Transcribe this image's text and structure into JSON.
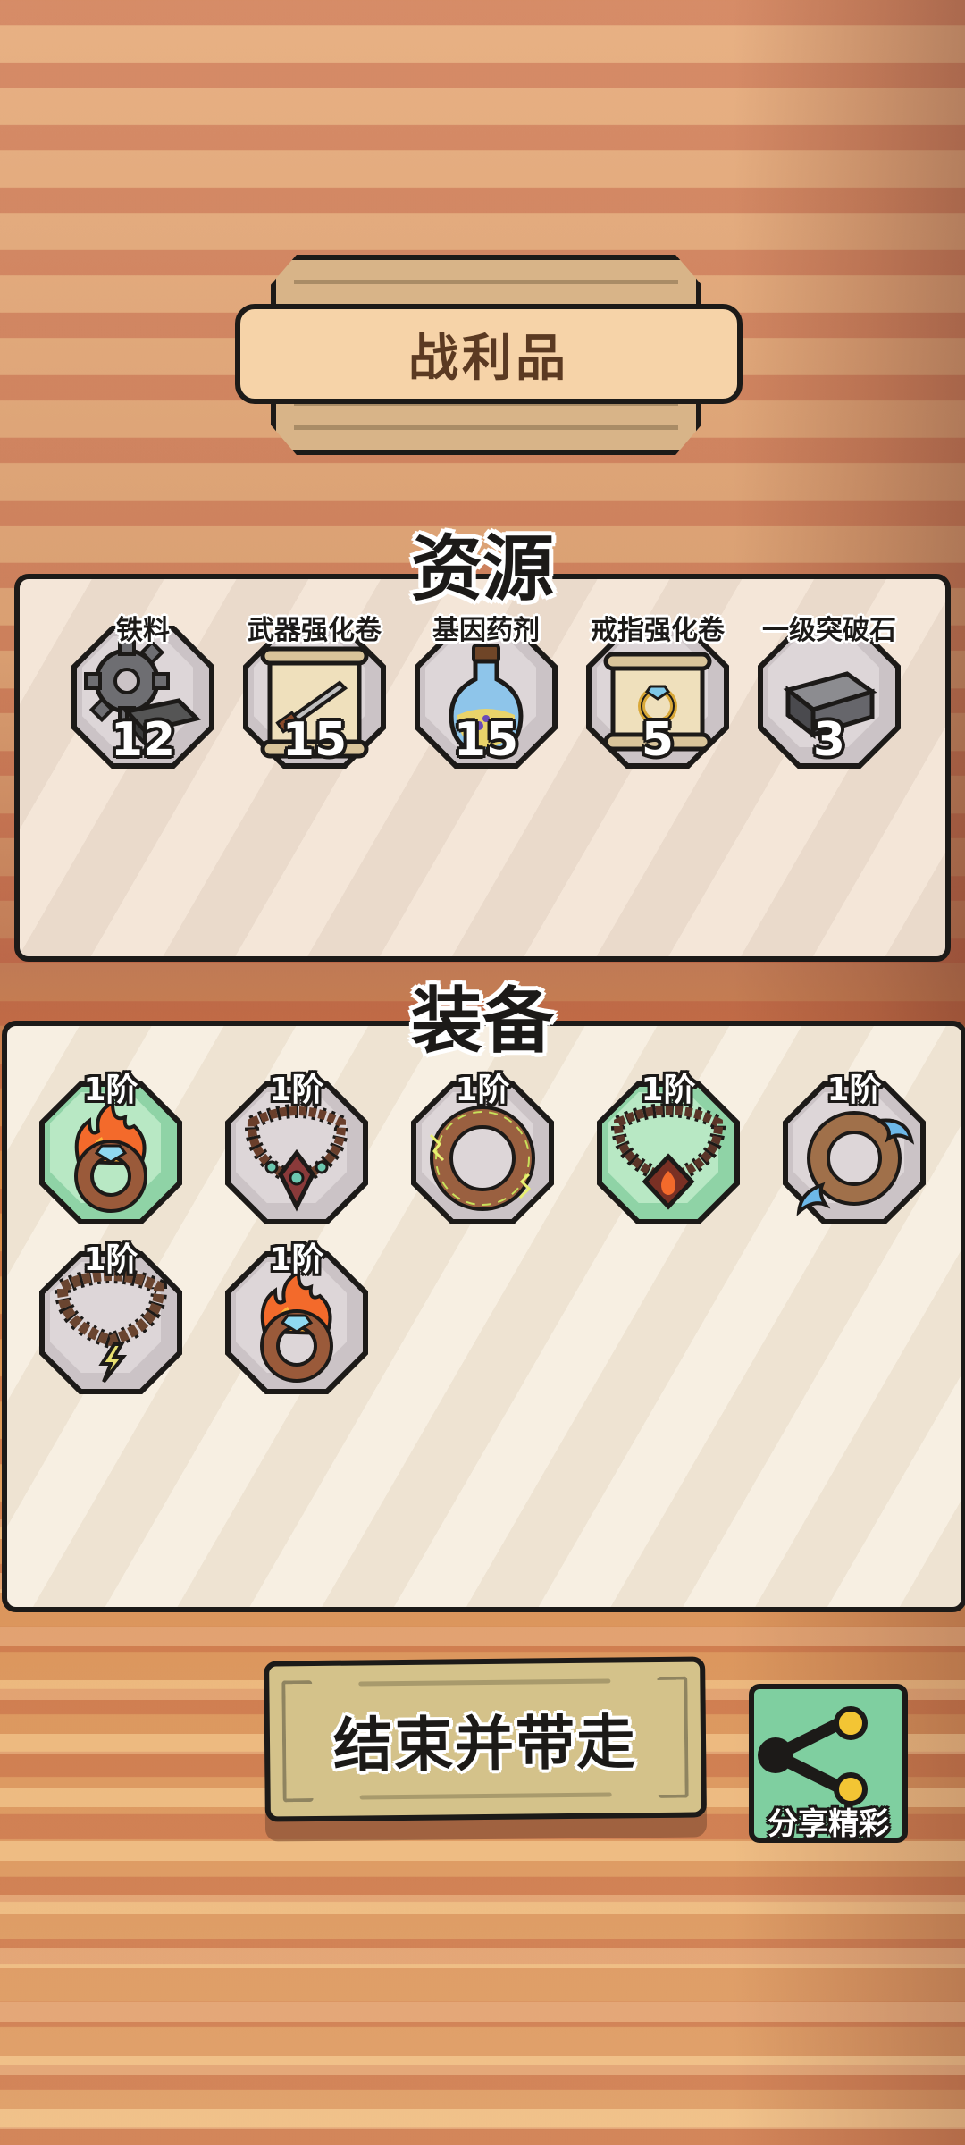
{
  "title_banner": {
    "text": "战利品"
  },
  "resources": {
    "heading": "资源",
    "items": [
      {
        "name": "铁料",
        "count": "12",
        "icon": "gear-iron-icon"
      },
      {
        "name": "武器强化卷",
        "count": "15",
        "icon": "weapon-scroll-icon"
      },
      {
        "name": "基因药剂",
        "count": "15",
        "icon": "potion-bottle-icon"
      },
      {
        "name": "戒指强化卷",
        "count": "5",
        "icon": "ring-scroll-icon"
      },
      {
        "name": "一级突破石",
        "count": "3",
        "icon": "breakthrough-stone-icon"
      }
    ]
  },
  "equipment": {
    "heading": "装备",
    "items": [
      {
        "tier": "1阶",
        "icon": "fire-ring-icon",
        "rarity": "green"
      },
      {
        "tier": "1阶",
        "icon": "bead-necklace-gem-icon",
        "rarity": "gray"
      },
      {
        "tier": "1阶",
        "icon": "lightning-ring-icon",
        "rarity": "gray"
      },
      {
        "tier": "1阶",
        "icon": "fire-bead-necklace-icon",
        "rarity": "green"
      },
      {
        "tier": "1阶",
        "icon": "water-ring-icon",
        "rarity": "gray"
      },
      {
        "tier": "1阶",
        "icon": "lightning-bead-necklace-icon",
        "rarity": "gray"
      },
      {
        "tier": "1阶",
        "icon": "fire-ring-icon",
        "rarity": "gray"
      }
    ]
  },
  "buttons": {
    "end_label": "结束并带走",
    "share_label": "分享精彩"
  },
  "colors": {
    "outline": "#1c1a18",
    "green_slot": "#8fd3a6",
    "share_button": "#7fcfa0",
    "end_button": "#d4c28a"
  }
}
